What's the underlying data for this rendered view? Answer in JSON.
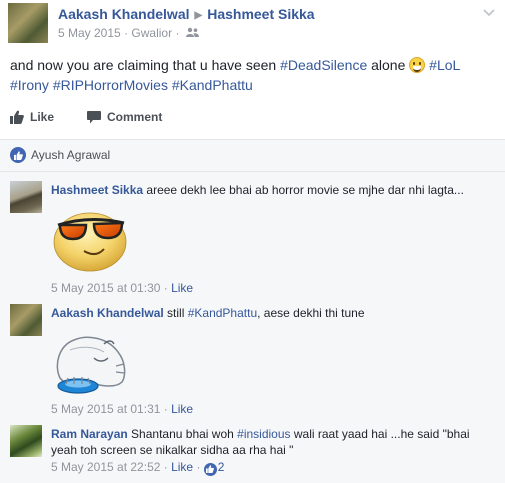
{
  "post": {
    "author": "Aakash Khandelwal",
    "target": "Hashmeet Sikka",
    "date": "5 May 2015",
    "sep": "·",
    "location": "Gwalior",
    "text_before": "and now you are claiming that u have seen ",
    "hashtag_deadsilence": "#DeadSilence",
    "text_alone": " alone ",
    "hashtag_lol": "#LoL",
    "hashtag_irony": "#Irony",
    "hashtag_riphorror": "#RIPHorrorMovies",
    "hashtag_kandphattu": "#KandPhattu"
  },
  "actions": {
    "like_label": "Like",
    "comment_label": "Comment"
  },
  "likes": {
    "names": "Ayush Agrawal"
  },
  "comments": [
    {
      "name": "Hashmeet Sikka",
      "text": " areee dekh lee bhai ab horror movie se mjhe dar nhi lagta...",
      "timestamp": "5 May 2015 at 01:30",
      "like": "Like"
    },
    {
      "name": "Aakash Khandelwal",
      "text_before": " still ",
      "hashtag": "#KandPhattu",
      "text_after": ", aese dekhi thi tune",
      "timestamp": "5 May 2015 at 01:31",
      "like": "Like"
    },
    {
      "name": "Ram Narayan",
      "text_before": " Shantanu bhai woh ",
      "hashtag": "#insidious",
      "text_line1_after": " wali raat yaad hai ...he said \"bhai",
      "text_line2": "yeah toh screen se nikalkar sidha aa rha hai \"",
      "timestamp": "5 May 2015 at 22:52",
      "like": "Like",
      "like_count": "2"
    }
  ],
  "icons": {
    "header": "friends-icon",
    "chevron": "chevron-down-icon",
    "like": "thumbs-up-icon",
    "comment": "speech-bubble-icon"
  },
  "colors": {
    "link": "#365899",
    "meta": "#90949c",
    "like_blue": "#4267b2"
  }
}
